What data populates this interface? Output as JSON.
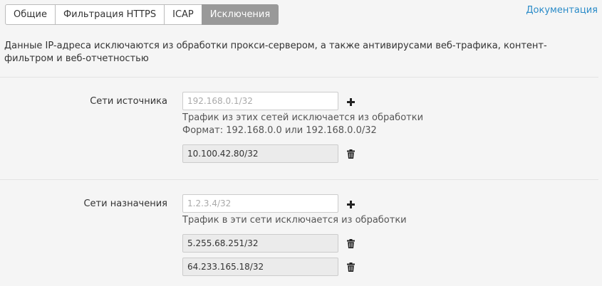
{
  "tabs": [
    {
      "label": "Общие"
    },
    {
      "label": "Фильтрация HTTPS"
    },
    {
      "label": "ICAP"
    },
    {
      "label": "Исключения"
    }
  ],
  "doc_link": "Документация",
  "description": "Данные IP-адреса исключаются из обработки прокси-сервером, а также антивирусами веб-трафика, контент-фильтром и веб-отчетностью",
  "source_networks": {
    "label": "Сети источника",
    "placeholder": "192.168.0.1/32",
    "hint_line1": "Трафик из этих сетей исключается из обработки",
    "hint_line2": "Формат: 192.168.0.0 или 192.168.0.0/32",
    "entries": [
      "10.100.42.80/32"
    ]
  },
  "destination_networks": {
    "label": "Сети назначения",
    "placeholder": "1.2.3.4/32",
    "hint_line1": "Трафик в эти сети исключается из обработки",
    "entries": [
      "5.255.68.251/32",
      "64.233.165.18/32"
    ]
  },
  "icons": {
    "add": "plus-icon",
    "delete": "trash-icon"
  },
  "colors": {
    "accent_link": "#2a8bc8",
    "active_tab": "#999999"
  }
}
